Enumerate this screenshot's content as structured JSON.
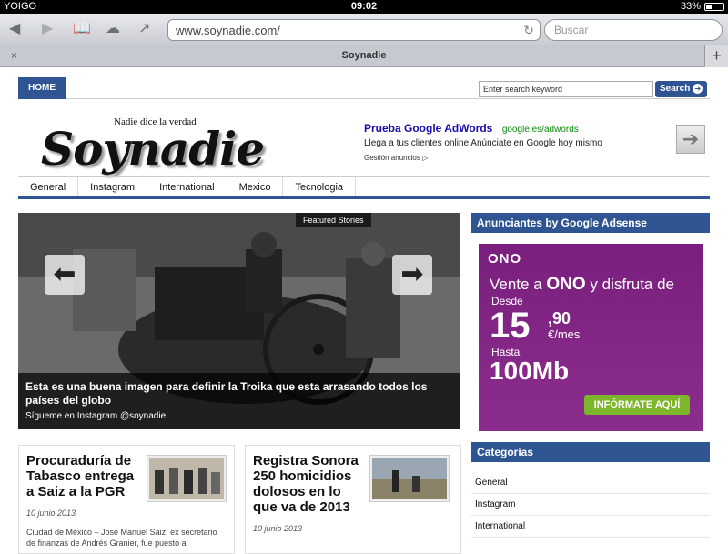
{
  "status": {
    "carrier": "YOIGO",
    "time": "09:02",
    "battery": "33%"
  },
  "browser": {
    "url": "www.soynadie.com/",
    "search_placeholder": "Buscar",
    "tab_title": "Soynadie",
    "tab_close": "×",
    "tab_add": "+"
  },
  "site": {
    "home_label": "HOME",
    "search_placeholder": "Enter search keyword",
    "search_button": "Search",
    "tagline": "Nadie dice la verdad",
    "logo_text": "Soynadie",
    "ad": {
      "title": "Prueba Google AdWords",
      "url": "google.es/adwords",
      "description": "Llega a tus clientes online Anúnciate en Google hoy mismo",
      "manage": "Gestión anuncios"
    },
    "nav": [
      "General",
      "Instagram",
      "International",
      "Mexico",
      "Tecnologia"
    ],
    "featured": {
      "badge": "Featured Stories",
      "title": "Esta es una buena imagen para definir la Troika que esta arrasando todos los países del globo",
      "subtitle": "Sígueme en Instagram @soynadie"
    },
    "sidebar": {
      "ads_heading": "Anunciantes by Google Adsense",
      "ono": {
        "logo": "ONO",
        "line1_a": "Vente a ",
        "line1_b": "ONO",
        "line1_c": " y disfruta de",
        "desde": "Desde",
        "price": "15",
        "cents": ",90",
        "per": "€/mes",
        "hasta": "Hasta",
        "speed": "100Mb",
        "cta": "INFÓRMATE AQUÍ"
      },
      "categories_heading": "Categorías",
      "categories": [
        "General",
        "Instagram",
        "International"
      ]
    },
    "articles": [
      {
        "title": "Procuraduría de Tabasco entrega a Saiz a la PGR",
        "date": "10 junio 2013",
        "excerpt": "Ciudad de México – José Manuel Saiz, ex secretario de finanzas de Andrés Granier, fue puesto a"
      },
      {
        "title": "Registra Sonora 250 homicidios dolosos en lo que va de 2013",
        "date": "10 junio 2013",
        "excerpt": ""
      }
    ]
  },
  "colors": {
    "accent": "#2e5592",
    "ono_purple": "#8b2d8d",
    "ono_green": "#7db52b"
  }
}
